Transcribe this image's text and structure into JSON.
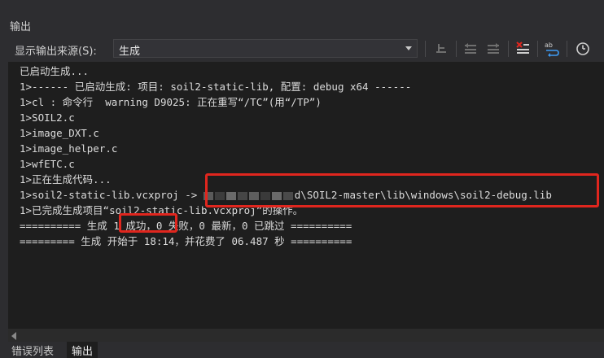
{
  "panel": {
    "title": "输出"
  },
  "toolbar": {
    "source_label": "显示输出来源(S):",
    "source_value": "生成"
  },
  "icons": {
    "find_message": "find-message-icon",
    "prev": "go-to-previous-icon",
    "next": "go-to-next-icon",
    "clear_all": "clear-all-icon",
    "word_wrap": "word-wrap-icon",
    "clock": "clock-icon"
  },
  "output": {
    "lines": [
      "已启动生成...",
      "1>------ 已启动生成: 项目: soil2-static-lib, 配置: debug x64 ------",
      "1>cl : 命令行  warning D9025: 正在重写“/TC”(用“/TP”)",
      "1>SOIL2.c",
      "1>image_DXT.c",
      "1>image_helper.c",
      "1>wfETC.c",
      "1>正在生成代码...",
      "1>soil2-static-lib.vcxproj -> ",
      "1>已完成生成项目“soil2-static-lib.vcxproj”的操作。",
      "========== 生成 ",
      "========= 生成 开始于 18:14，并花费了 06.487 秒 =========="
    ],
    "line9_tail": "d\\SOIL2-master\\lib\\windows\\soil2-debug.lib",
    "line11_success": "1 成功",
    "line11_rest": "，0 失败，0 最新，0 已跳过 =========="
  },
  "tabs": [
    {
      "label": "错误列表"
    },
    {
      "label": "输出"
    }
  ],
  "colors": {
    "highlight_box": "#e0261e",
    "redaction": "#5a5a5a"
  }
}
